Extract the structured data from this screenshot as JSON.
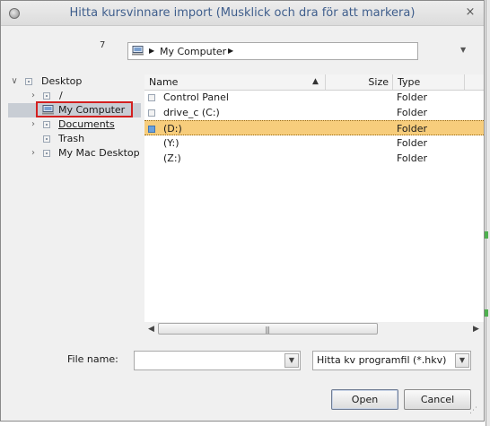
{
  "window": {
    "title": "Hitta kursvinnare import  (Musklick och dra för att markera)",
    "close_glyph": "×"
  },
  "pathbar": {
    "prefix_mark": "7",
    "label": "My Computer"
  },
  "tree": {
    "items": [
      {
        "label": "Desktop",
        "expander": "open"
      },
      {
        "label": "/",
        "expander": "closed"
      },
      {
        "label": "My Computer",
        "expander": "none",
        "selected": true
      },
      {
        "label": "Documents",
        "expander": "closed"
      },
      {
        "label": "Trash",
        "expander": "none"
      },
      {
        "label": "My Mac Desktop",
        "expander": "closed"
      }
    ]
  },
  "list": {
    "columns": {
      "name": "Name",
      "size": "Size",
      "type": "Type"
    },
    "rows": [
      {
        "name": "Control Panel",
        "type": "Folder"
      },
      {
        "name": "drive_c (C:)",
        "type": "Folder"
      },
      {
        "name": "(D:)",
        "type": "Folder",
        "selected": true
      },
      {
        "name": "(Y:)",
        "type": "Folder"
      },
      {
        "name": "(Z:)",
        "type": "Folder"
      }
    ]
  },
  "controls": {
    "filename_label": "File name:",
    "filename_value": "",
    "filter_value": "Hitta kv programfil (*.hkv)",
    "open_label": "Open",
    "cancel_label": "Cancel"
  },
  "colors": {
    "selection": "#f7cd7c",
    "highlight_box": "#d32020",
    "title_text": "#3f5e8c"
  }
}
